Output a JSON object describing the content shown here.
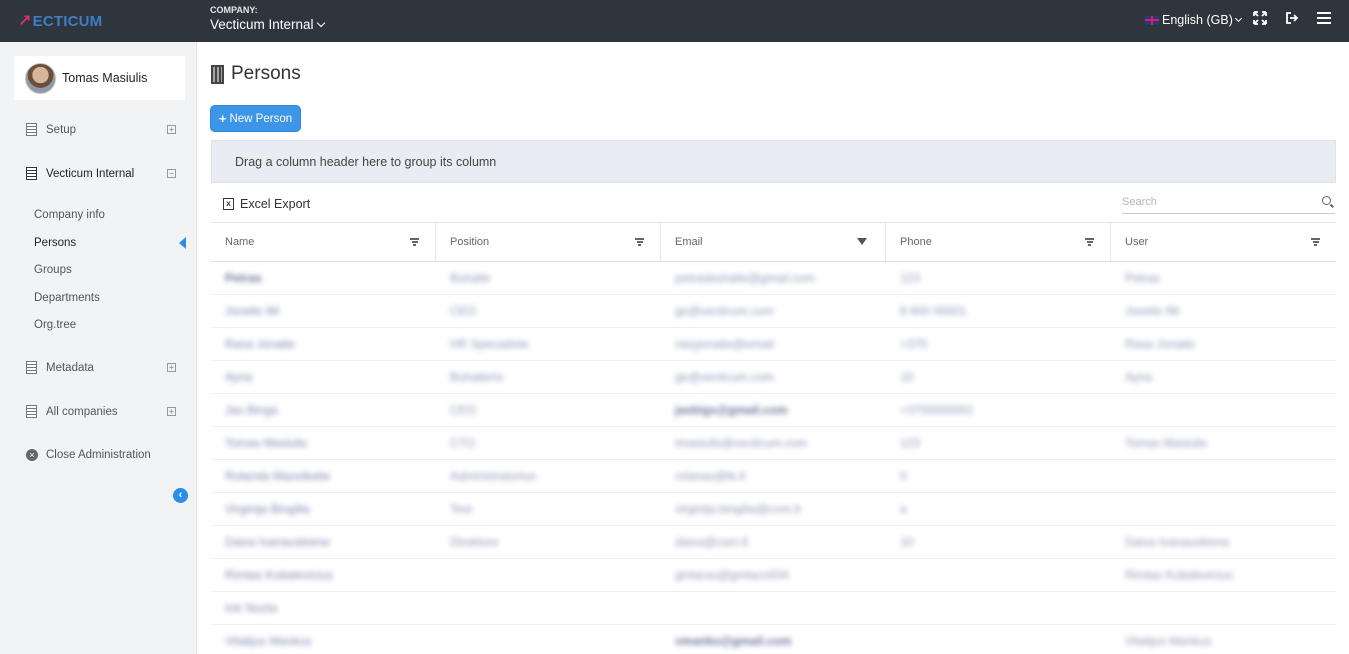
{
  "topbar": {
    "logo": "ECTICUM",
    "company_label": "COMPANY:",
    "company_name": "Vecticum Internal",
    "language": "English (GB)",
    "icons": [
      "expand-icon",
      "logout-icon",
      "menu-icon"
    ]
  },
  "sidebar": {
    "user_name": "Tomas Masiulis",
    "items": [
      {
        "label": "Setup",
        "toggle": "+"
      },
      {
        "label": "Vecticum Internal",
        "toggle": "−"
      },
      {
        "label": "Metadata",
        "toggle": "+"
      },
      {
        "label": "All companies",
        "toggle": "+"
      },
      {
        "label": "Close Administration"
      }
    ],
    "sub_items": [
      "Company info",
      "Persons",
      "Groups",
      "Departments",
      "Org.tree"
    ],
    "active_sub_item": "Persons"
  },
  "main": {
    "title": "Persons",
    "new_button": "New Person",
    "group_hint": "Drag a column header here to group its column",
    "excel_export": "Excel Export",
    "search_placeholder": "Search",
    "columns": [
      "Name",
      "Position",
      "Email",
      "Phone",
      "User"
    ],
    "rows": [
      [
        "Petras",
        "Buhalte",
        "petrasbuhalte@gmail.com",
        "123",
        "Petras"
      ],
      [
        "Jonelis IM",
        "CEO",
        "ge@vecticum.com",
        "8 600 00001",
        "Jonelis IM"
      ],
      [
        "Rasa Jonaite",
        "HR Specialiste",
        "rasyjonaite@email",
        "+370",
        "Rasa Jonaite"
      ],
      [
        "Ayna",
        "Buhalteris",
        "ge@vecticum.com",
        "10",
        "Ayna"
      ],
      [
        "Jas Binga",
        "CEO",
        "jasbigs@gmail.com",
        "+3700000001",
        ""
      ],
      [
        "Tomas Masiulis",
        "CTO",
        "tmasiulis@vecticum.com",
        "123",
        "Tomas Masiulis"
      ],
      [
        "Rolanda Mazeikaite",
        "Administratorius",
        "rolanas@tk.lt",
        "0",
        ""
      ],
      [
        "Virginija Bingilia",
        "Test",
        "virginija.bingilia@com.lt",
        "a",
        ""
      ],
      [
        "Daiva Ivanauskiene",
        "Direktore",
        "daiva@com.lt",
        "10",
        "Daiva Ivanauskiene"
      ],
      [
        "Rimtas Kubalevicius",
        "",
        "gintaras@gmtacv934",
        "",
        "Rimtas Kubalevicius"
      ],
      [
        "Intr Nozta",
        "",
        "",
        "",
        ""
      ],
      [
        "Vitalijus Mankus",
        "",
        "vmanko@gmail.com",
        "",
        "Vitalijus Mankus"
      ]
    ]
  },
  "colors": {
    "topbar": "#2f353d",
    "accent": "#3d95e8",
    "sidebar": "#f2f3f5"
  }
}
